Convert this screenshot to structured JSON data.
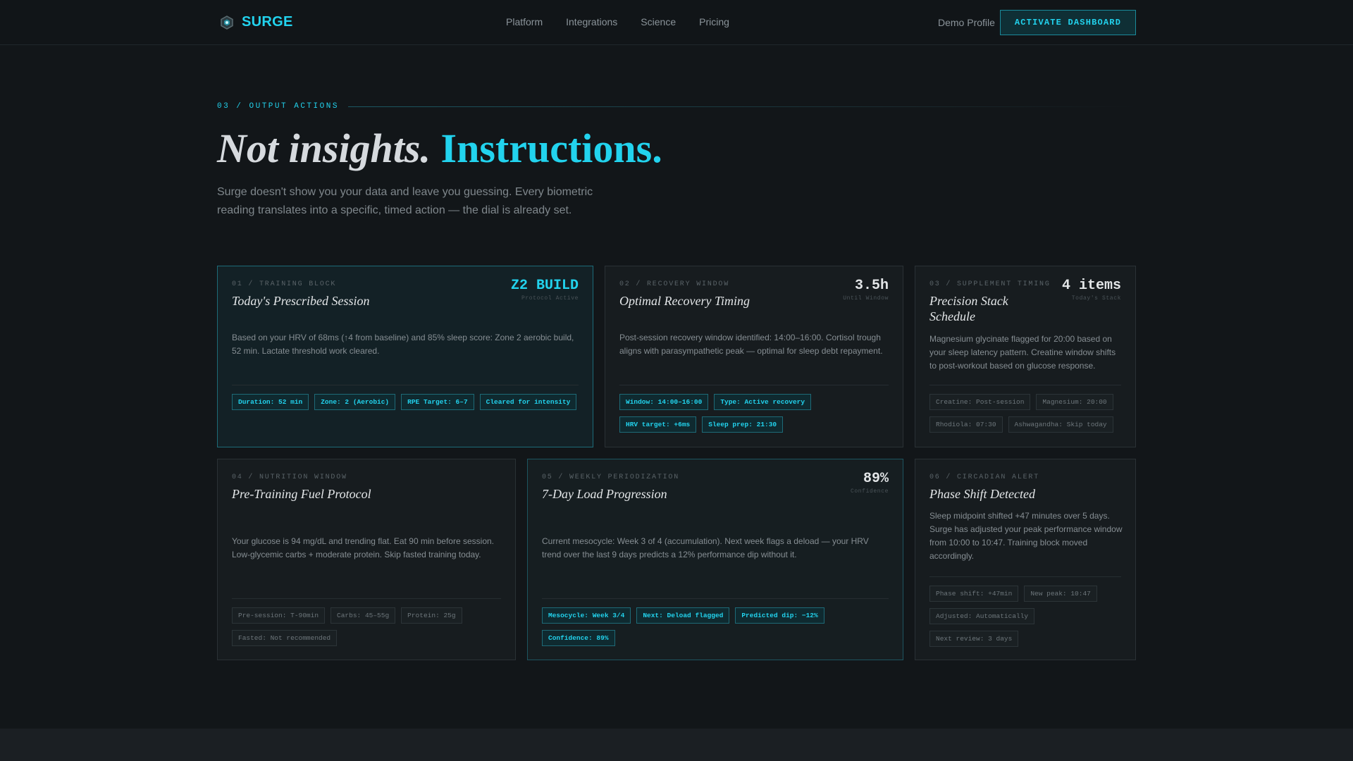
{
  "nav": {
    "brand": "SURGE",
    "links": [
      "Platform",
      "Integrations",
      "Science",
      "Pricing"
    ],
    "demo_profile": "Demo Profile",
    "cta": "ACTIVATE DASHBOARD"
  },
  "section": {
    "eyebrow": "03 / OUTPUT ACTIONS",
    "headline_italic": "Not insights.",
    "headline_accent": "Instructions.",
    "lede": "Surge doesn't show you your data and leave you guessing. Every biometric reading translates into a specific, timed action — the dial is already set."
  },
  "cards": [
    {
      "meta": "01 / TRAINING BLOCK",
      "title": "Today's Prescribed Session",
      "stat_value": "Z2 BUILD",
      "stat_label": "Protocol Active",
      "desc": "Based on your HRV of 68ms (↑4 from baseline) and 85% sleep score: Zone 2 aerobic build, 52 min. Lactate threshold work cleared.",
      "tags": [
        "Duration: 52 min",
        "Zone: 2 (Aerobic)",
        "RPE Target: 6–7",
        "Cleared for intensity"
      ]
    },
    {
      "meta": "02 / RECOVERY WINDOW",
      "title": "Optimal Recovery Timing",
      "stat_value": "3.5h",
      "stat_label": "Until Window",
      "desc": "Post-session recovery window identified: 14:00–16:00. Cortisol trough aligns with parasympathetic peak — optimal for sleep debt repayment.",
      "tags": [
        "Window: 14:00–16:00",
        "Type: Active recovery",
        "HRV target: +6ms",
        "Sleep prep: 21:30"
      ]
    },
    {
      "meta": "03 / SUPPLEMENT TIMING",
      "title": "Precision Stack Schedule",
      "stat_value": "4 items",
      "stat_label": "Today's Stack",
      "desc": "Magnesium glycinate flagged for 20:00 based on your sleep latency pattern. Creatine window shifts to post-workout based on glucose response.",
      "tags": [
        "Creatine: Post-session",
        "Magnesium: 20:00",
        "Rhodiola: 07:30",
        "Ashwagandha: Skip today"
      ]
    },
    {
      "meta": "04 / NUTRITION WINDOW",
      "title": "Pre-Training Fuel Protocol",
      "stat_value": "",
      "stat_label": "",
      "desc": "Your glucose is 94 mg/dL and trending flat. Eat 90 min before session. Low-glycemic carbs + moderate protein. Skip fasted training today.",
      "tags": [
        "Pre-session: T-90min",
        "Carbs: 45–55g",
        "Protein: 25g",
        "Fasted: Not recommended"
      ]
    },
    {
      "meta": "05 / WEEKLY PERIODIZATION",
      "title": "7-Day Load Progression",
      "stat_value": "89%",
      "stat_label": "Confidence",
      "desc": "Current mesocycle: Week 3 of 4 (accumulation). Next week flags a deload — your HRV trend over the last 9 days predicts a 12% performance dip without it.",
      "tags": [
        "Mesocycle: Week 3/4",
        "Next: Deload flagged",
        "Predicted dip: −12%",
        "Confidence: 89%"
      ]
    },
    {
      "meta": "06 / CIRCADIAN ALERT",
      "title": "Phase Shift Detected",
      "stat_value": "",
      "stat_label": "",
      "desc": "Sleep midpoint shifted +47 minutes over 5 days. Surge has adjusted your peak performance window from 10:00 to 10:47. Training block moved accordingly.",
      "tags": [
        "Phase shift: +47min",
        "New peak: 10:47",
        "Adjusted: Automatically",
        "Next review: 3 days"
      ]
    }
  ],
  "colors": {
    "accent": "#22d3ee",
    "background": "#121619",
    "card": "#171c1f"
  },
  "icons": {
    "logo": "hexagon-logo-icon"
  }
}
